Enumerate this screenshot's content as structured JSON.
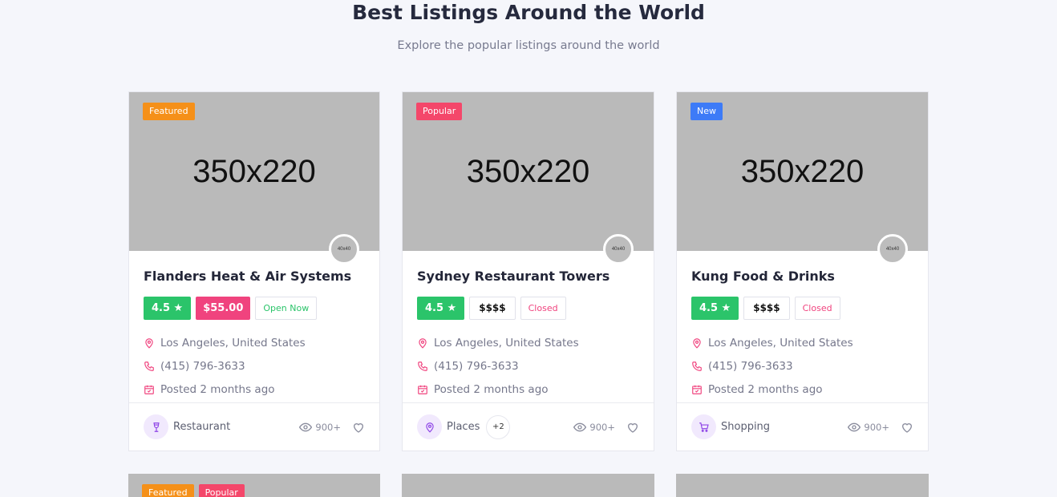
{
  "section": {
    "title": "Best Listings Around the World",
    "subtitle": "Explore the popular listings around the world"
  },
  "listings": [
    {
      "image_text": "350x220",
      "badges": [
        {
          "label": "Featured",
          "kind": "featured"
        }
      ],
      "avatar_text": "40x40",
      "title": "Flanders Heat & Air Systems",
      "rating": "4.5 ★",
      "price": "$55.00",
      "status": "Open Now",
      "location": "Los Angeles, United States",
      "phone": "(415) 796-3633",
      "posted": "Posted 2 months ago",
      "category": "Restaurant",
      "category_icon": "wine-glass-icon",
      "views": "900+"
    },
    {
      "image_text": "350x220",
      "badges": [
        {
          "label": "Popular",
          "kind": "popular"
        }
      ],
      "avatar_text": "40x40",
      "title": "Sydney Restaurant Towers",
      "rating": "4.5 ★",
      "price": "$$$$",
      "status": "Closed",
      "location": "Los Angeles, United States",
      "phone": "(415) 796-3633",
      "posted": "Posted 2 months ago",
      "category": "Places",
      "category_icon": "map-pin-icon",
      "extra_count": "+2",
      "views": "900+"
    },
    {
      "image_text": "350x220",
      "badges": [
        {
          "label": "New",
          "kind": "new"
        }
      ],
      "avatar_text": "40x40",
      "title": "Kung Food & Drinks",
      "rating": "4.5 ★",
      "price": "$$$$",
      "status": "Closed",
      "location": "Los Angeles, United States",
      "phone": "(415) 796-3633",
      "posted": "Posted 2 months ago",
      "category": "Shopping",
      "category_icon": "shopping-cart-icon",
      "views": "900+"
    }
  ],
  "second_row": [
    {
      "badges": [
        {
          "label": "Featured",
          "kind": "featured"
        },
        {
          "label": "Popular",
          "kind": "popular"
        }
      ]
    },
    {
      "badges": []
    },
    {
      "badges": []
    }
  ],
  "colors": {
    "rating_green": "#2bc46a",
    "price_pink": "#f0437e",
    "featured_orange": "#f59019",
    "popular_red": "#f4476a",
    "new_blue": "#3d7bf7",
    "category_purple": "#8e44e6"
  }
}
